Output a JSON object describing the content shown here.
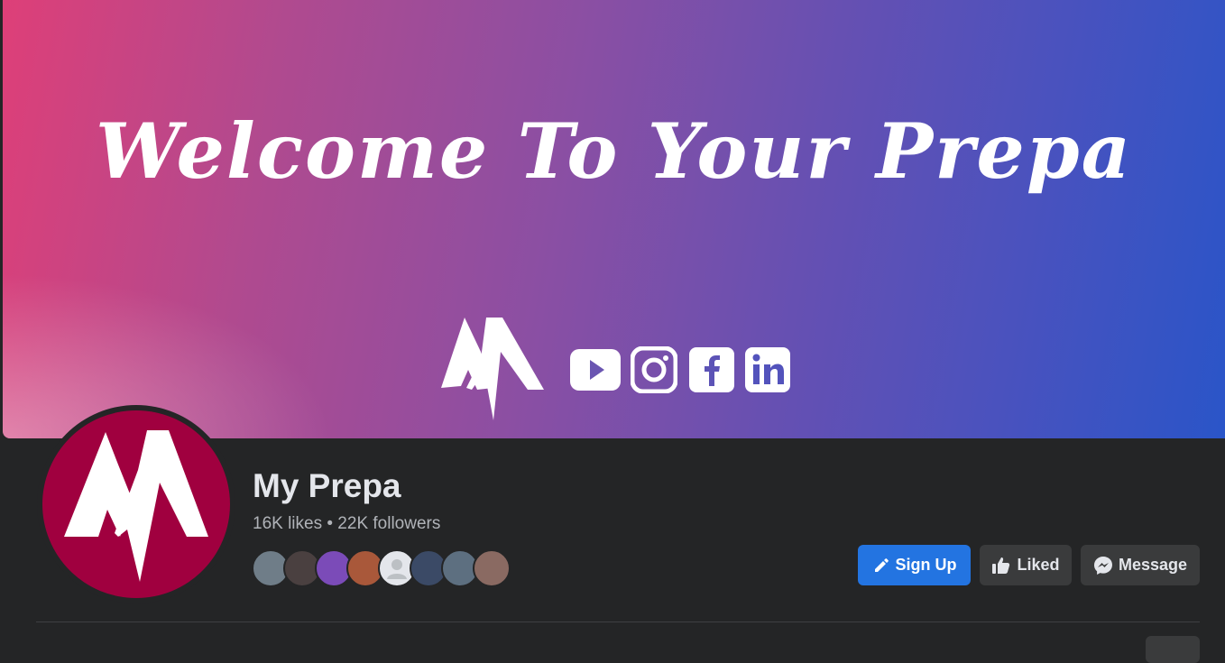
{
  "cover": {
    "title": "Welcome To Your Prepa",
    "logo": "my-prepa-m-logo",
    "social_icons": [
      "youtube-icon",
      "instagram-icon",
      "facebook-icon",
      "linkedin-icon"
    ],
    "gradient_colors": [
      "#de3f78",
      "#8b4fa3",
      "#2a55c8"
    ]
  },
  "profile": {
    "name": "My Prepa",
    "stats": "16K likes • 22K followers",
    "avatar_color": "#a0003f",
    "friend_avatars": [
      {
        "name": "friend-avatar-1",
        "color": "#6f7d88"
      },
      {
        "name": "friend-avatar-2",
        "color": "#4a4040"
      },
      {
        "name": "friend-avatar-3",
        "color": "#7b4bb8"
      },
      {
        "name": "friend-avatar-4",
        "color": "#a9583a"
      },
      {
        "name": "friend-avatar-5",
        "color": "#c9ccd1"
      },
      {
        "name": "friend-avatar-6",
        "color": "#3b4a66"
      },
      {
        "name": "friend-avatar-7",
        "color": "#5d6f80"
      },
      {
        "name": "friend-avatar-8",
        "color": "#8a6a62"
      }
    ]
  },
  "actions": {
    "signup_label": "Sign Up",
    "liked_label": "Liked",
    "message_label": "Message"
  },
  "colors": {
    "primary": "#2374e1",
    "background": "#242526",
    "secondary_button": "#3a3b3c"
  }
}
